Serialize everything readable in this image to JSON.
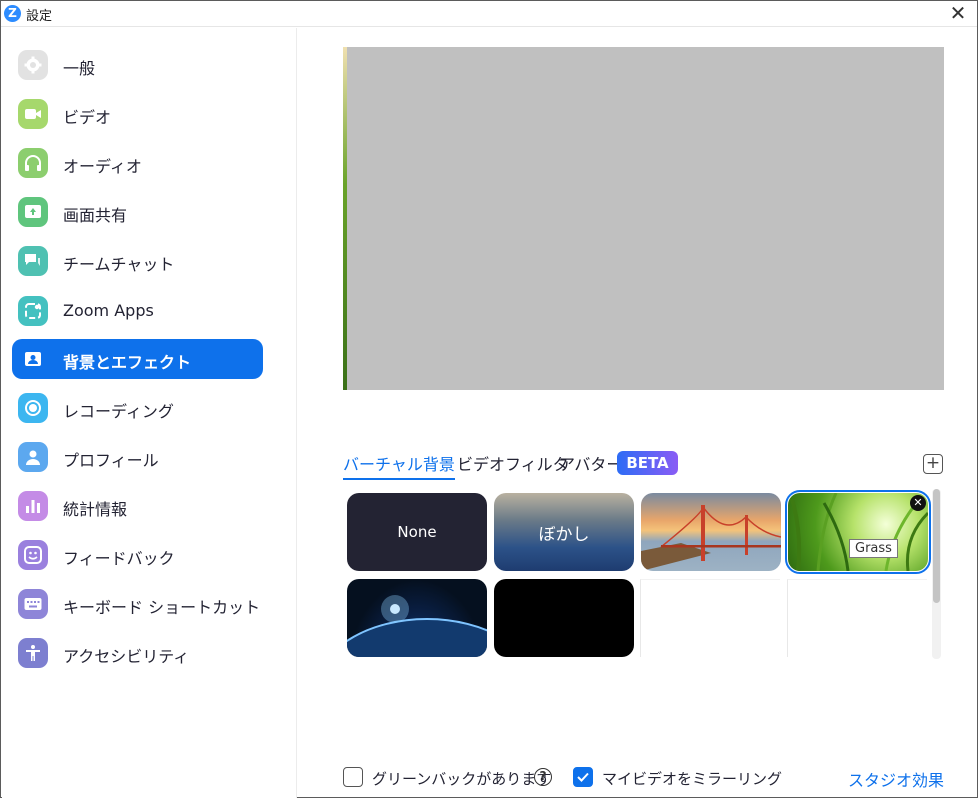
{
  "window": {
    "title": "設定",
    "app_icon_letter": "Z",
    "close_glyph": "✕"
  },
  "sidebar": {
    "items": [
      {
        "label": "一般",
        "icon": "gear-icon",
        "color": "#e2e2e2"
      },
      {
        "label": "ビデオ",
        "icon": "video-camera-icon",
        "color": "#a6d86c"
      },
      {
        "label": "オーディオ",
        "icon": "headphones-icon",
        "color": "#8cce6e"
      },
      {
        "label": "画面共有",
        "icon": "share-screen-icon",
        "color": "#5fc57d"
      },
      {
        "label": "チームチャット",
        "icon": "chat-icon",
        "color": "#4fc1b2"
      },
      {
        "label": "Zoom Apps",
        "icon": "apps-icon",
        "color": "#44c1c0"
      },
      {
        "label": "背景とエフェクト",
        "icon": "background-icon",
        "color": "#0e71eb",
        "active": true
      },
      {
        "label": "レコーディング",
        "icon": "record-icon",
        "color": "#3cb6f0"
      },
      {
        "label": "プロフィール",
        "icon": "profile-icon",
        "color": "#5ca8ef"
      },
      {
        "label": "統計情報",
        "icon": "statistics-icon",
        "color": "#c48be6"
      },
      {
        "label": "フィードバック",
        "icon": "smiley-icon",
        "color": "#9a80de"
      },
      {
        "label": "キーボード ショートカット",
        "icon": "keyboard-icon",
        "color": "#8e85d8"
      },
      {
        "label": "アクセシビリティ",
        "icon": "accessibility-icon",
        "color": "#7d7fd0"
      }
    ]
  },
  "tabs": {
    "virtual_bg": "バーチャル背景",
    "video_filter": "ビデオフィルタ",
    "avatar": "アバター",
    "beta": "BETA",
    "add": "+"
  },
  "thumbnails": {
    "none_label": "None",
    "blur_label": "ぼかし",
    "grass_tooltip": "Grass",
    "close_glyph": "✕"
  },
  "bottom": {
    "green_screen_label": "グリーンバックがあります",
    "green_screen_checked": false,
    "help_glyph": "?",
    "mirror_label": "マイビデオをミラーリング",
    "mirror_checked": true,
    "studio_link": "スタジオ効果"
  },
  "colors": {
    "accent": "#0e71eb"
  }
}
